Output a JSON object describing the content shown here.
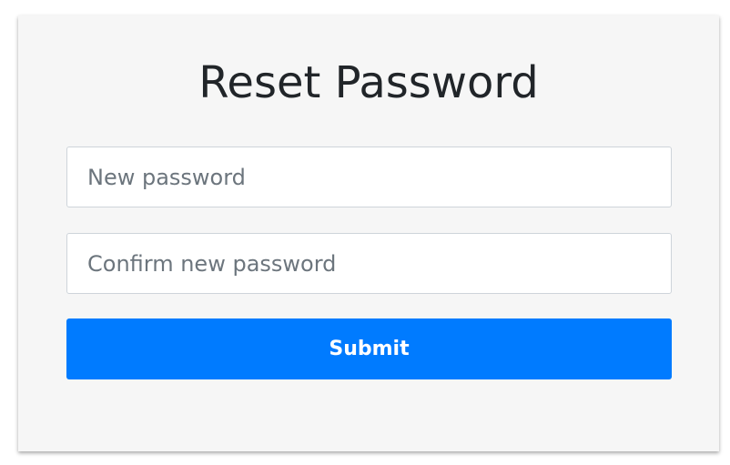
{
  "form": {
    "title": "Reset Password",
    "new_password": {
      "value": "",
      "placeholder": "New password"
    },
    "confirm_password": {
      "value": "",
      "placeholder": "Confirm new password"
    },
    "submit_label": "Submit"
  },
  "colors": {
    "card_background": "#f6f6f6",
    "title_text": "#212529",
    "placeholder_text": "#6c757d",
    "input_border": "#ced4da",
    "submit_background": "#007bff",
    "submit_text": "#ffffff"
  }
}
